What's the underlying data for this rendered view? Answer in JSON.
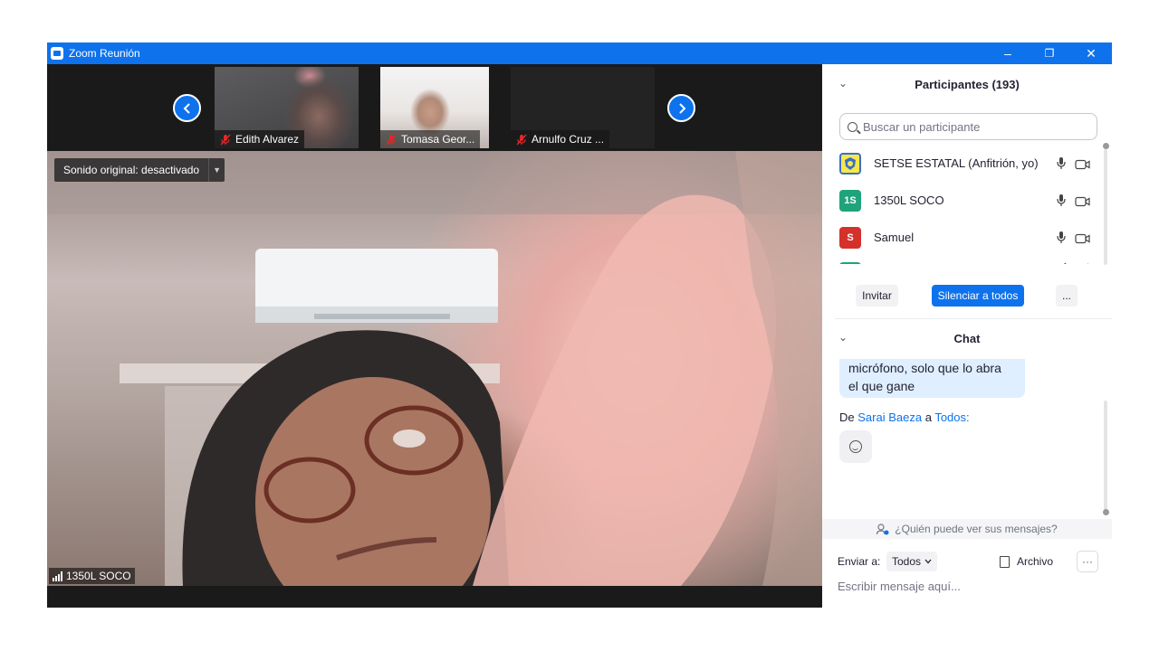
{
  "window": {
    "title": "Zoom Reunión",
    "minimize": "–",
    "restore": "❐",
    "close": "✕"
  },
  "gallery": {
    "prev_arrow": "‹",
    "next_arrow": "›",
    "thumbnails": [
      {
        "name": "Edith Alvarez",
        "muted": true
      },
      {
        "name": "Tomasa Geor...",
        "muted": true
      },
      {
        "name": "Arnulfo Cruz ...",
        "muted": true
      }
    ]
  },
  "main_video": {
    "sound_toggle": "Sonido original: desactivado",
    "speaker_name": "1350L SOCO"
  },
  "participants": {
    "header": "Participantes (193)",
    "search_placeholder": "Buscar un participante",
    "list": [
      {
        "avatar_text": "",
        "name": "SETSE ESTATAL (Anfitrión, yo)",
        "avatar_color": "#f6e84a",
        "mic": "on",
        "video": "off"
      },
      {
        "avatar_text": "1S",
        "name": "1350L SOCO",
        "avatar_color": "#1fa37a",
        "mic": "on",
        "video": "off"
      },
      {
        "avatar_text": "S",
        "name": "Samuel",
        "avatar_color": "#d4312b",
        "mic": "on",
        "video": "off"
      },
      {
        "avatar_text": "",
        "name": "",
        "avatar_color": "#1fa37a",
        "mic": "muted",
        "video": "off"
      }
    ],
    "buttons": {
      "invite": "Invitar",
      "mute_all": "Silenciar a todos",
      "more": "..."
    }
  },
  "chat": {
    "header": "Chat",
    "messages": [
      {
        "line1": "micrófono, solo que lo abra",
        "line2": "el que gane"
      }
    ],
    "last_sender": {
      "prefix": "De",
      "sender": "Sarai Baeza",
      "mid": "a",
      "recipient": "Todos:"
    },
    "who_can_see": "¿Quién puede ver sus mensajes?",
    "send_to_label": "Enviar a:",
    "send_to_value": "Todos",
    "file_label": "Archivo",
    "options": "···",
    "compose_placeholder": "Escribir mensaje aquí..."
  }
}
